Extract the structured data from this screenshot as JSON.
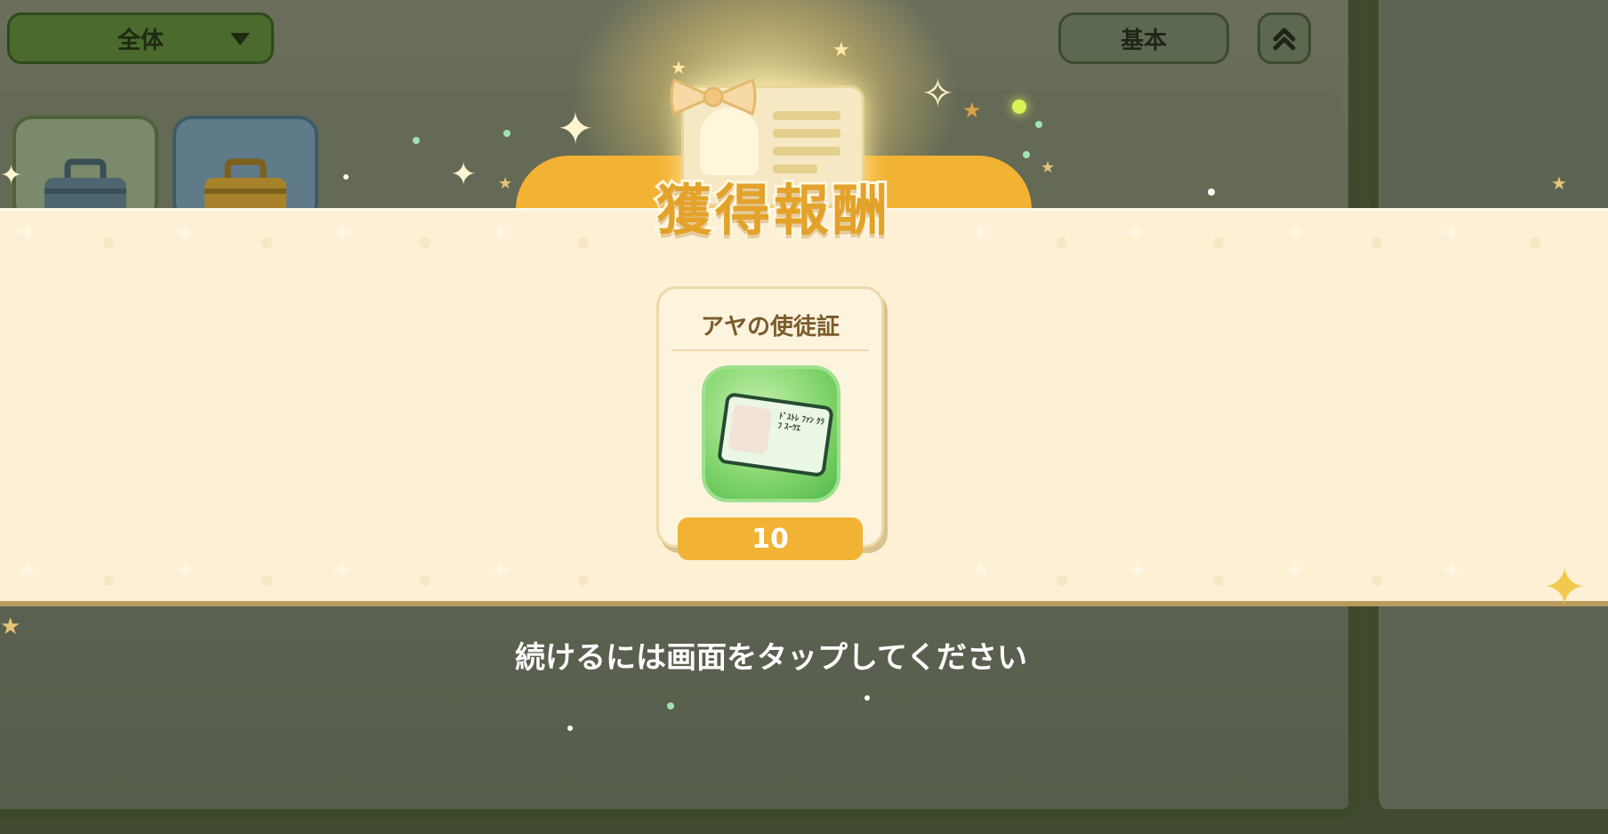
{
  "header": {
    "filter_dropdown_label": "全体",
    "basic_button_label": "基本",
    "collapse_icon": "double-chevron-up-icon"
  },
  "reward_popup": {
    "title": "獲得報酬",
    "item": {
      "name": "アヤの使徒証",
      "quantity": "10",
      "icon": "disciple-id-card-icon",
      "card_text": "ﾄﾞｽﾄﾚ ﾌｧﾝ ｸﾗﾌ ｽｰﾂｴ"
    },
    "tap_hint": "続けるには画面をタップしてください"
  },
  "colors": {
    "accent_orange": "#f2b233",
    "band_cream": "#fdf0d4",
    "dropdown_green": "#4a6a2e",
    "item_green": "#7fd46a"
  }
}
